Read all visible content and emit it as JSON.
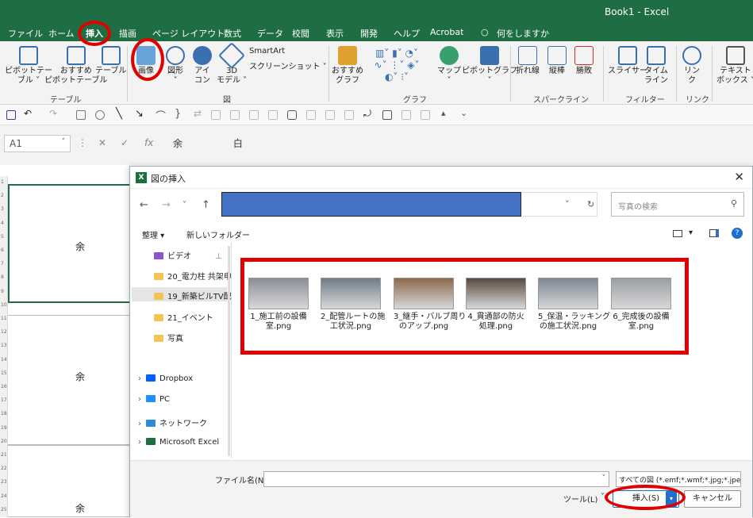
{
  "app": {
    "title": "Book1 - Excel"
  },
  "tabs": [
    "ファイル",
    "ホーム",
    "挿入",
    "描画",
    "ページ レイアウト",
    "数式",
    "データ",
    "校閲",
    "表示",
    "開発",
    "ヘルプ",
    "Acrobat",
    "何をしますか"
  ],
  "ribbon": {
    "buttons": [
      {
        "label": "ピボットテー\nブル ˅"
      },
      {
        "label": "おすすめ\nピボットテーブル"
      },
      {
        "label": "テーブル"
      },
      {
        "label": "画像"
      },
      {
        "label": "図形\n˅"
      },
      {
        "label": "アイ\nコン"
      },
      {
        "label": "3D\nモデル ˅"
      },
      {
        "label": "SmartArt"
      },
      {
        "label": "スクリーンショット ˅"
      },
      {
        "label": "おすすめ\nグラフ"
      },
      {
        "label": "マップ\n˅"
      },
      {
        "label": "ピボットグラフ\n˅"
      },
      {
        "label": "折れ線"
      },
      {
        "label": "縦棒"
      },
      {
        "label": "勝敗"
      },
      {
        "label": "スライサー"
      },
      {
        "label": "タイム\nライン"
      },
      {
        "label": "リン\nク"
      },
      {
        "label": "テキスト\nボックス ˅"
      }
    ],
    "groups": [
      "テーブル",
      "図",
      "グラフ",
      "スパークライン",
      "フィルター",
      "リンク"
    ]
  },
  "formula": {
    "namebox": "A1",
    "content": "余 白",
    "fx": "fx"
  },
  "sheet": {
    "cell_text": "余 白",
    "rows": [
      "1",
      "2",
      "3",
      "4",
      "5",
      "6",
      "7",
      "8",
      "9",
      "10",
      "11",
      "12",
      "13",
      "14",
      "15",
      "16",
      "17",
      "18",
      "19",
      "20",
      "21",
      "22",
      "23",
      "24",
      "25"
    ]
  },
  "dialog": {
    "title": "図の挿入",
    "search_placeholder": "写真の検索",
    "toolbar": {
      "organize": "整理 ▾",
      "new_folder": "新しいフォルダー"
    },
    "nav_items": [
      {
        "label": "ビデオ",
        "icon": "video-icon"
      },
      {
        "label": "20_電力柱 共架申",
        "icon": "folder-icon"
      },
      {
        "label": "19_新築ビルTV配",
        "icon": "folder-icon",
        "selected": true
      },
      {
        "label": "21_イベント",
        "icon": "folder-icon"
      },
      {
        "label": "写真",
        "icon": "folder-icon"
      },
      {
        "label": "Dropbox",
        "icon": "dropbox-icon"
      },
      {
        "label": "PC",
        "icon": "pc-icon"
      },
      {
        "label": "ネットワーク",
        "icon": "network-icon"
      },
      {
        "label": "Microsoft Excel",
        "icon": "excel-icon"
      }
    ],
    "files": [
      {
        "name": "1_施工前の設備\n室.png",
        "color": "#8a8f96"
      },
      {
        "name": "2_配管ルートの施\n工状況.png",
        "color": "#6f7c88"
      },
      {
        "name": "3_継手・バルブ周り\nのアップ.png",
        "color": "#8c6a4d"
      },
      {
        "name": "4_貫通部の防火\n処理.png",
        "color": "#5a4a3d"
      },
      {
        "name": "5_保温・ラッキング\nの施工状況.png",
        "color": "#7d8794"
      },
      {
        "name": "6_完成後の設備\n室.png",
        "color": "#9a9ea4"
      }
    ],
    "filename_label": "ファイル名(N):",
    "filename_value": "",
    "filetype": "すべての図 (*.emf;*.wmf;*.jpg;*.jpeg",
    "tools_label": "ツール(L)",
    "insert_label": "挿入(S)",
    "cancel_label": "キャンセル"
  },
  "colors": {
    "excel_green": "#1f6e43",
    "highlight": "#e00000",
    "path_fill": "#4472c4"
  }
}
